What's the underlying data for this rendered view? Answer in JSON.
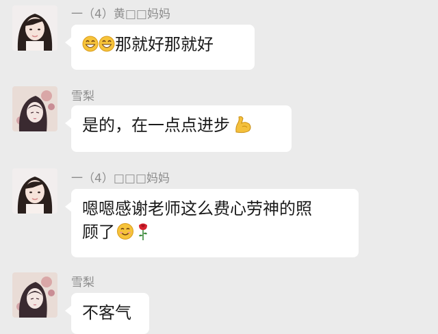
{
  "messages": [
    {
      "sender": "一（4）黄□□妈妈",
      "avatar": "girl-avatar",
      "text_after_emoji": "那就好那就好",
      "emojis": [
        "grin-emoji",
        "grin-emoji"
      ]
    },
    {
      "sender": "雪梨",
      "avatar": "anime-avatar",
      "text": "是的，在一点点进步",
      "emojis": [
        "flexed-bicep-emoji"
      ]
    },
    {
      "sender": "一（4）□□□妈妈",
      "avatar": "girl-avatar",
      "text_line1": "嗯嗯感谢老师这么费心劳神的照",
      "text_line2": "顾了",
      "emojis": [
        "smile-emoji",
        "rose-emoji"
      ]
    },
    {
      "sender": "雪梨",
      "avatar": "anime-avatar",
      "text": "不客气"
    }
  ],
  "colors": {
    "background": "#ebebeb",
    "bubble": "#ffffff",
    "sender_text": "#8c8c8c",
    "message_text": "#1a1a1a"
  }
}
